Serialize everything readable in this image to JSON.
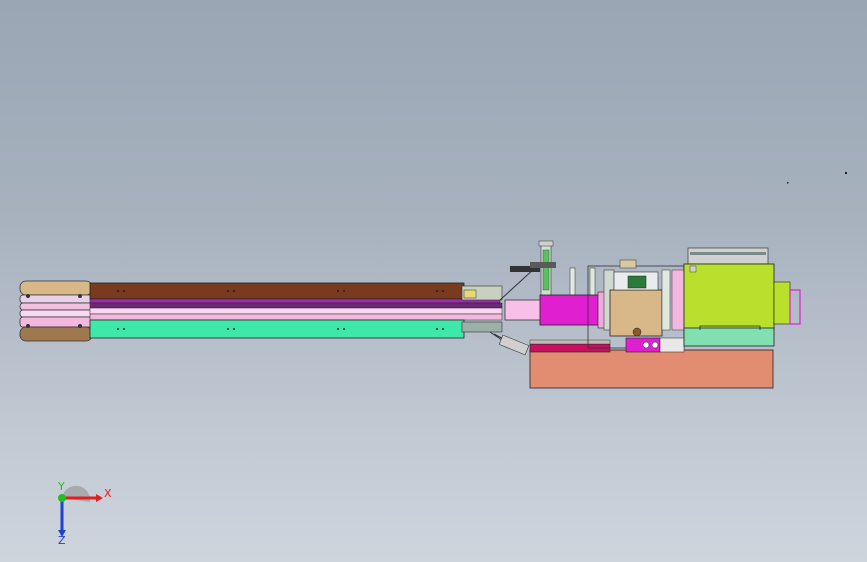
{
  "viewport": {
    "background_top": "#9aa6b4",
    "background_bottom": "#cfd5dd"
  },
  "model": {
    "part_colors": {
      "brown_rail": "#7a3a1e",
      "green_rail": "#3ee8a8",
      "magenta_block": "#e020d0",
      "pink_tube": "#f4b8e0",
      "yellow_green_motor": "#b8e02c",
      "base_plate": "#e28c72",
      "tan_block": "#d8b888",
      "purple_band": "#7a2a86"
    }
  },
  "triad": {
    "x_label": "X",
    "y_label": "Y",
    "z_label": "Z",
    "x_color": "#e02020",
    "y_color": "#20c020",
    "z_color": "#2040d0"
  }
}
